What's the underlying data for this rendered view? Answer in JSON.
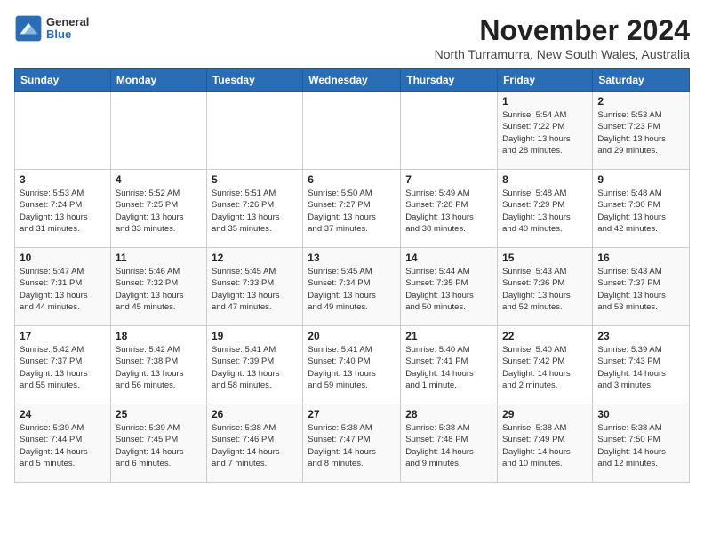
{
  "header": {
    "logo_general": "General",
    "logo_blue": "Blue",
    "month_year": "November 2024",
    "location": "North Turramurra, New South Wales, Australia"
  },
  "days_of_week": [
    "Sunday",
    "Monday",
    "Tuesday",
    "Wednesday",
    "Thursday",
    "Friday",
    "Saturday"
  ],
  "weeks": [
    [
      {
        "day": "",
        "info": ""
      },
      {
        "day": "",
        "info": ""
      },
      {
        "day": "",
        "info": ""
      },
      {
        "day": "",
        "info": ""
      },
      {
        "day": "",
        "info": ""
      },
      {
        "day": "1",
        "info": "Sunrise: 5:54 AM\nSunset: 7:22 PM\nDaylight: 13 hours\nand 28 minutes."
      },
      {
        "day": "2",
        "info": "Sunrise: 5:53 AM\nSunset: 7:23 PM\nDaylight: 13 hours\nand 29 minutes."
      }
    ],
    [
      {
        "day": "3",
        "info": "Sunrise: 5:53 AM\nSunset: 7:24 PM\nDaylight: 13 hours\nand 31 minutes."
      },
      {
        "day": "4",
        "info": "Sunrise: 5:52 AM\nSunset: 7:25 PM\nDaylight: 13 hours\nand 33 minutes."
      },
      {
        "day": "5",
        "info": "Sunrise: 5:51 AM\nSunset: 7:26 PM\nDaylight: 13 hours\nand 35 minutes."
      },
      {
        "day": "6",
        "info": "Sunrise: 5:50 AM\nSunset: 7:27 PM\nDaylight: 13 hours\nand 37 minutes."
      },
      {
        "day": "7",
        "info": "Sunrise: 5:49 AM\nSunset: 7:28 PM\nDaylight: 13 hours\nand 38 minutes."
      },
      {
        "day": "8",
        "info": "Sunrise: 5:48 AM\nSunset: 7:29 PM\nDaylight: 13 hours\nand 40 minutes."
      },
      {
        "day": "9",
        "info": "Sunrise: 5:48 AM\nSunset: 7:30 PM\nDaylight: 13 hours\nand 42 minutes."
      }
    ],
    [
      {
        "day": "10",
        "info": "Sunrise: 5:47 AM\nSunset: 7:31 PM\nDaylight: 13 hours\nand 44 minutes."
      },
      {
        "day": "11",
        "info": "Sunrise: 5:46 AM\nSunset: 7:32 PM\nDaylight: 13 hours\nand 45 minutes."
      },
      {
        "day": "12",
        "info": "Sunrise: 5:45 AM\nSunset: 7:33 PM\nDaylight: 13 hours\nand 47 minutes."
      },
      {
        "day": "13",
        "info": "Sunrise: 5:45 AM\nSunset: 7:34 PM\nDaylight: 13 hours\nand 49 minutes."
      },
      {
        "day": "14",
        "info": "Sunrise: 5:44 AM\nSunset: 7:35 PM\nDaylight: 13 hours\nand 50 minutes."
      },
      {
        "day": "15",
        "info": "Sunrise: 5:43 AM\nSunset: 7:36 PM\nDaylight: 13 hours\nand 52 minutes."
      },
      {
        "day": "16",
        "info": "Sunrise: 5:43 AM\nSunset: 7:37 PM\nDaylight: 13 hours\nand 53 minutes."
      }
    ],
    [
      {
        "day": "17",
        "info": "Sunrise: 5:42 AM\nSunset: 7:37 PM\nDaylight: 13 hours\nand 55 minutes."
      },
      {
        "day": "18",
        "info": "Sunrise: 5:42 AM\nSunset: 7:38 PM\nDaylight: 13 hours\nand 56 minutes."
      },
      {
        "day": "19",
        "info": "Sunrise: 5:41 AM\nSunset: 7:39 PM\nDaylight: 13 hours\nand 58 minutes."
      },
      {
        "day": "20",
        "info": "Sunrise: 5:41 AM\nSunset: 7:40 PM\nDaylight: 13 hours\nand 59 minutes."
      },
      {
        "day": "21",
        "info": "Sunrise: 5:40 AM\nSunset: 7:41 PM\nDaylight: 14 hours\nand 1 minute."
      },
      {
        "day": "22",
        "info": "Sunrise: 5:40 AM\nSunset: 7:42 PM\nDaylight: 14 hours\nand 2 minutes."
      },
      {
        "day": "23",
        "info": "Sunrise: 5:39 AM\nSunset: 7:43 PM\nDaylight: 14 hours\nand 3 minutes."
      }
    ],
    [
      {
        "day": "24",
        "info": "Sunrise: 5:39 AM\nSunset: 7:44 PM\nDaylight: 14 hours\nand 5 minutes."
      },
      {
        "day": "25",
        "info": "Sunrise: 5:39 AM\nSunset: 7:45 PM\nDaylight: 14 hours\nand 6 minutes."
      },
      {
        "day": "26",
        "info": "Sunrise: 5:38 AM\nSunset: 7:46 PM\nDaylight: 14 hours\nand 7 minutes."
      },
      {
        "day": "27",
        "info": "Sunrise: 5:38 AM\nSunset: 7:47 PM\nDaylight: 14 hours\nand 8 minutes."
      },
      {
        "day": "28",
        "info": "Sunrise: 5:38 AM\nSunset: 7:48 PM\nDaylight: 14 hours\nand 9 minutes."
      },
      {
        "day": "29",
        "info": "Sunrise: 5:38 AM\nSunset: 7:49 PM\nDaylight: 14 hours\nand 10 minutes."
      },
      {
        "day": "30",
        "info": "Sunrise: 5:38 AM\nSunset: 7:50 PM\nDaylight: 14 hours\nand 12 minutes."
      }
    ]
  ]
}
